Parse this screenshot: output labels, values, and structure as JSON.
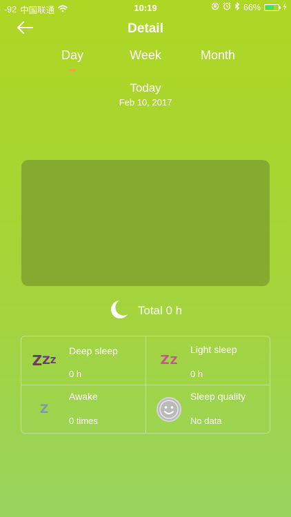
{
  "status_bar": {
    "signal": "-92",
    "carrier": "中国联通",
    "time": "10:19",
    "battery": "66%",
    "battery_level": 0.66
  },
  "header": {
    "title": "Detail"
  },
  "tabs": [
    {
      "label": "Day",
      "active": true
    },
    {
      "label": "Week",
      "active": false
    },
    {
      "label": "Month",
      "active": false
    }
  ],
  "date": {
    "title": "Today",
    "subtitle": "Feb 10, 2017"
  },
  "total": {
    "label": "Total 0 h"
  },
  "stats": {
    "deep_sleep": {
      "label": "Deep sleep",
      "value": "0 h"
    },
    "light_sleep": {
      "label": "Light sleep",
      "value": "0 h"
    },
    "awake": {
      "label": "Awake",
      "value": "0 times"
    },
    "sleep_quality": {
      "label": "Sleep quality",
      "value": "No data"
    }
  },
  "icons": {
    "back": "arrow-left-icon",
    "moon": "moon-icon",
    "deep_sleep": "zzz-icon",
    "light_sleep": "zz-icon",
    "awake": "z-icon",
    "quality": "smiley-icon"
  },
  "colors": {
    "tab_indicator": "#f5a045",
    "chart_background": "#86aa30",
    "deep_sleep_icon": "#6b3a6e",
    "light_sleep_icon": "#c0578f",
    "awake_icon": "#7a9aa8"
  }
}
